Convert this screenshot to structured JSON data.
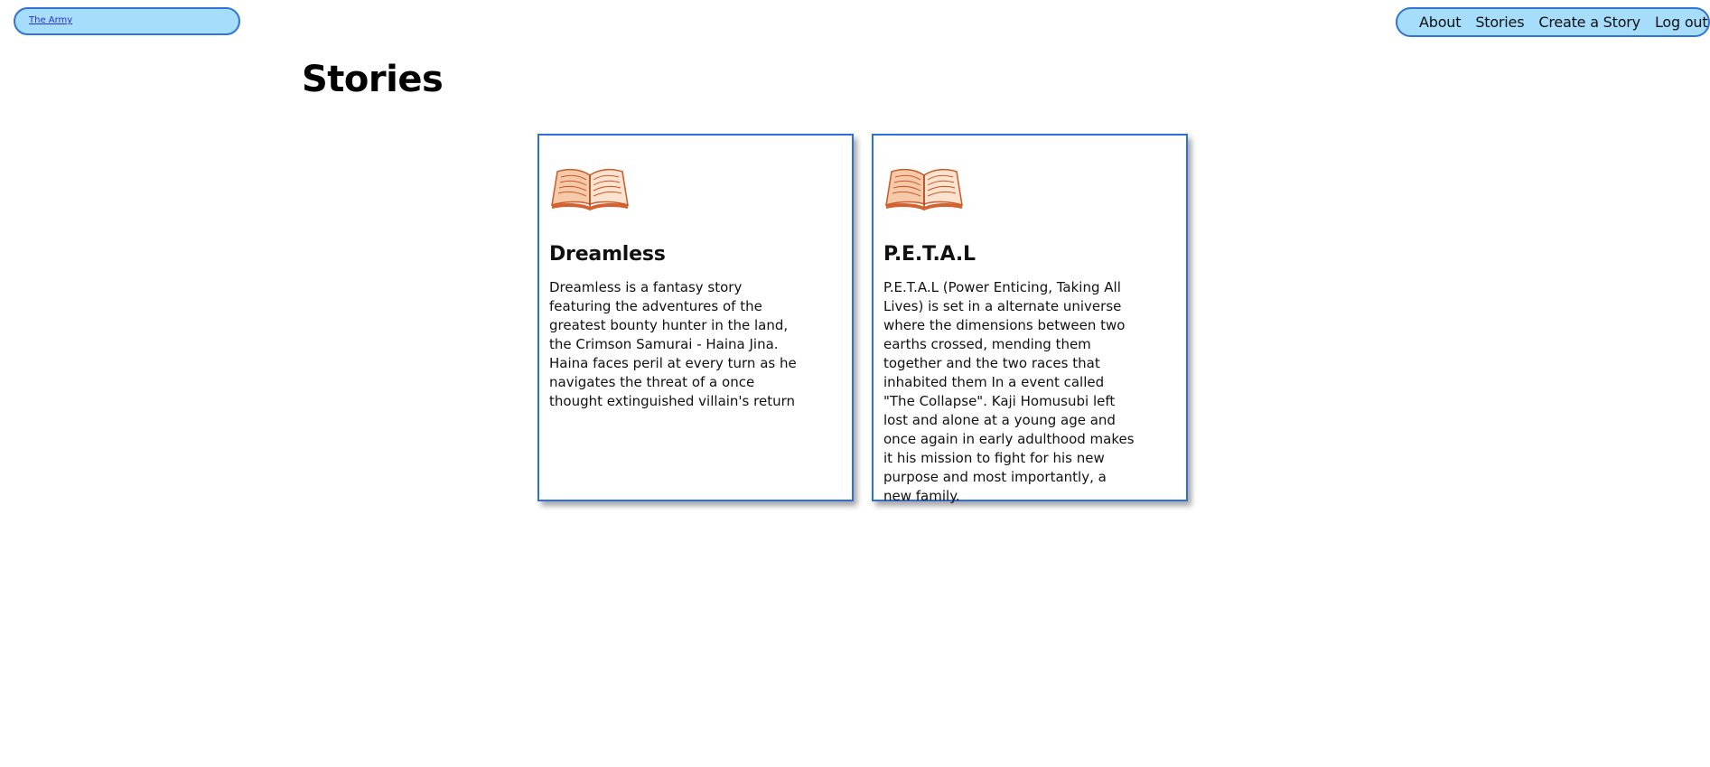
{
  "header": {
    "brand_label": "The Army",
    "nav": [
      {
        "label": "About"
      },
      {
        "label": "Stories"
      },
      {
        "label": "Create a Story"
      },
      {
        "label": "Log out"
      }
    ]
  },
  "main": {
    "title": "Stories",
    "stories": [
      {
        "icon": "open-book-icon",
        "title": "Dreamless",
        "description": "Dreamless is a fantasy story featuring the adventures of the greatest bounty hunter in the land, the Crimson Samurai - Haina Jina. Haina faces peril at every turn as he navigates the threat of a once thought extinguished villain's return"
      },
      {
        "icon": "open-book-icon",
        "title": "P.E.T.A.L",
        "description": "P.E.T.A.L (Power Enticing, Taking All Lives) is set in a alternate universe where the dimensions between two earths crossed, mending them together and the two races that inhabited them In a event called \"The Collapse\". Kaji Homusubi left lost and alone at a young age and once again in early adulthood makes it his mission to fight for his new purpose and most importantly, a new family."
      }
    ]
  },
  "colors": {
    "pill_background": "#a5ddfb",
    "pill_border": "#2f74d6",
    "card_border": "#2f6fdc",
    "link": "#2a2fcf",
    "book_icon": "#d4622e"
  }
}
